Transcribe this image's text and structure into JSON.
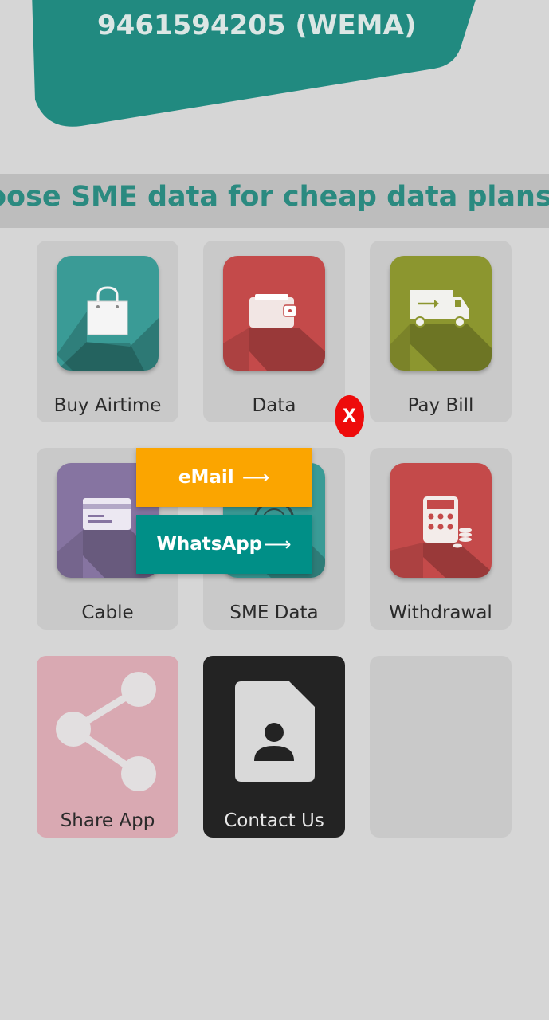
{
  "account": {
    "number_label": "9461594205 (WEMA)",
    "banner_color": "#218a80"
  },
  "marquee": {
    "text": "oose SME data for cheap data plans"
  },
  "tiles": [
    {
      "label": "Buy Airtime",
      "icon": "shopping-bag-icon",
      "color": "#3a9b96"
    },
    {
      "label": "Data",
      "icon": "wallet-icon",
      "color": "#c44a4a"
    },
    {
      "label": "Pay Bill",
      "icon": "delivery-truck-icon",
      "color": "#8c962f"
    },
    {
      "label": "Cable",
      "icon": "credit-card-icon",
      "color": "#8674a1"
    },
    {
      "label": "SME Data",
      "icon": "sme-data-icon",
      "color": "#3a9b96"
    },
    {
      "label": "Withdrawal",
      "icon": "calculator-icon",
      "color": "#c44a4a"
    },
    {
      "label": "Share App",
      "icon": "share-icon",
      "color": "#d9a9b2"
    },
    {
      "label": "Contact Us",
      "icon": "contact-card-icon",
      "color": "#232323"
    }
  ],
  "popup": {
    "close_label": "X",
    "email_label": "eMail",
    "whatsapp_label": "WhatsApp",
    "arrow": "⟶",
    "email_color": "#fba500",
    "whatsapp_color": "#008f87",
    "close_color": "#ee0b0b"
  }
}
